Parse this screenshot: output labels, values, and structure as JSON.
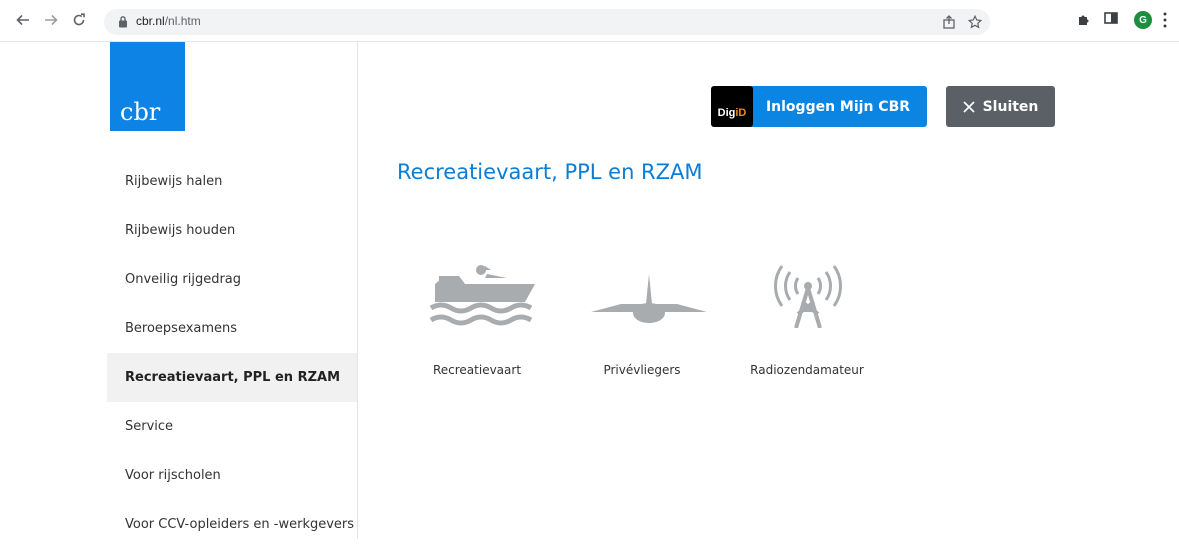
{
  "browser": {
    "url_host": "cbr.nl",
    "url_path": "/nl.htm",
    "profile_initial": "G"
  },
  "logo": {
    "text": "cbr"
  },
  "sidebar": {
    "items": [
      {
        "label": "Rijbewijs halen"
      },
      {
        "label": "Rijbewijs houden"
      },
      {
        "label": "Onveilig rijgedrag"
      },
      {
        "label": "Beroepsexamens"
      },
      {
        "label": "Recreatievaart, PPL en RZAM",
        "active": true
      },
      {
        "label": "Service"
      },
      {
        "label": "Voor rijscholen"
      },
      {
        "label": "Voor CCV-opleiders en -werkgevers"
      }
    ]
  },
  "header": {
    "digid_logo_a": "Dig",
    "digid_logo_b": "iD",
    "login_label": "Inloggen Mijn CBR",
    "close_label": "Sluiten"
  },
  "main": {
    "title": "Recreatievaart, PPL en RZAM",
    "tiles": [
      {
        "label": "Recreatievaart",
        "icon": "boat-icon"
      },
      {
        "label": "Privévliegers",
        "icon": "airplane-icon"
      },
      {
        "label": "Radiozendamateur",
        "icon": "radio-tower-icon"
      }
    ]
  },
  "colors": {
    "brand_blue": "#0d83e6",
    "title_blue": "#0b7dd6",
    "close_button": "#5a6066",
    "icon_gray": "#a8acaf"
  }
}
